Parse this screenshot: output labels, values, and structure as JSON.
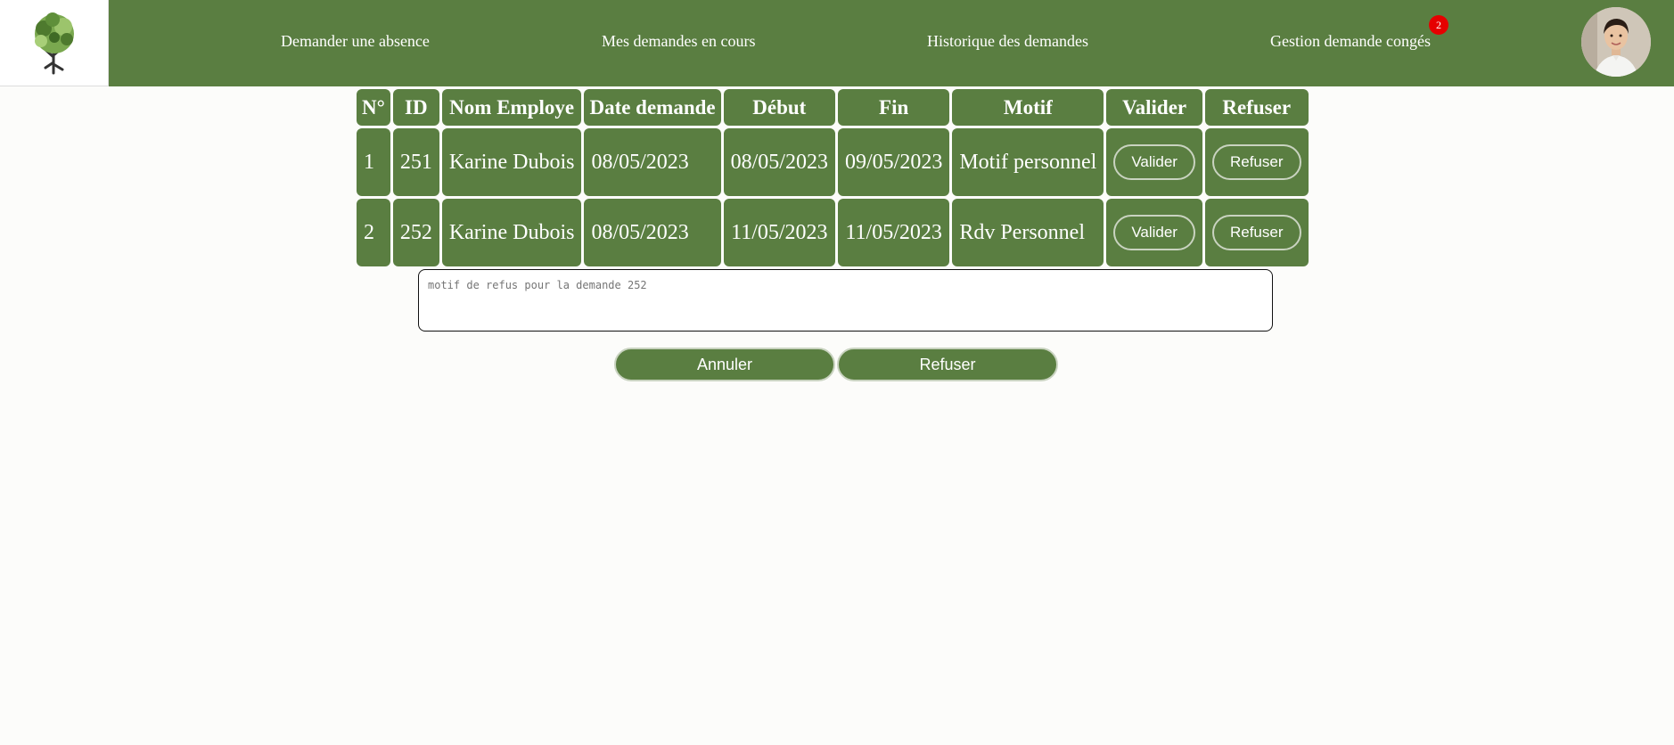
{
  "nav": {
    "items": [
      {
        "label": "Demander une absence"
      },
      {
        "label": "Mes demandes en cours"
      },
      {
        "label": "Historique des demandes"
      },
      {
        "label": "Gestion demande congés"
      }
    ],
    "notification_count": "2"
  },
  "table": {
    "headers": [
      "N°",
      "ID",
      "Nom Employe",
      "Date demande",
      "Début",
      "Fin",
      "Motif",
      "Valider",
      "Refuser"
    ],
    "rows": [
      {
        "num": "1",
        "id": "251",
        "name": "Karine Dubois",
        "date": "08/05/2023",
        "start": "08/05/2023",
        "end": "09/05/2023",
        "reason": "Motif personnel",
        "validate_label": "Valider",
        "refuse_label": "Refuser"
      },
      {
        "num": "2",
        "id": "252",
        "name": "Karine Dubois",
        "date": "08/05/2023",
        "start": "11/05/2023",
        "end": "11/05/2023",
        "reason": "Rdv Personnel",
        "validate_label": "Valider",
        "refuse_label": "Refuser"
      }
    ]
  },
  "refusal": {
    "placeholder": "motif de refus pour la demande 252",
    "cancel_label": "Annuler",
    "refuse_label": "Refuser"
  },
  "colors": {
    "accent": "#5a7e41",
    "badge": "#e60000",
    "background": "#fcfcfa"
  },
  "icons": {
    "logo": "tree-logo-icon",
    "avatar": "user-avatar"
  }
}
